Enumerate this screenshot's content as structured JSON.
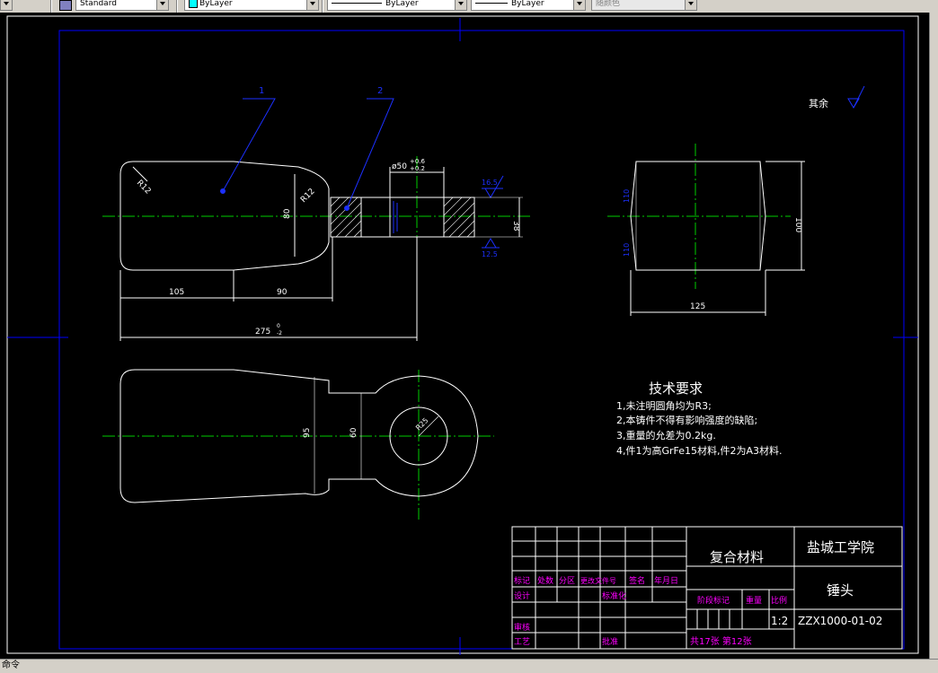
{
  "toolbar": {
    "style_combo": "Standard",
    "layer_combo": "ByLayer",
    "linetype_combo": "ByLayer",
    "lineweight_combo": "ByLayer",
    "plotstyle_combo": "随颜色"
  },
  "command_line": "命令",
  "drawing": {
    "balloon_1": "1",
    "balloon_2": "2",
    "roughness_note": "其余",
    "dims": {
      "r12_a": "R12",
      "r12_b": "R12",
      "d80_front": "80",
      "phi50": "ø50",
      "tol_upper": "+0.6",
      "tol_lower": "+0.2",
      "rough_165": "16.5",
      "rough_125": "12.5",
      "d38": "38",
      "d105": "105",
      "d90": "90",
      "d275": "275",
      "d275_tol_upper": "0",
      "d275_tol_lower": "-2",
      "side_110a": "110",
      "side_110b": "110",
      "side_100": "100",
      "side_125": "125",
      "top_95": "95",
      "top_60": "60",
      "r25": "R25"
    },
    "tech_req": {
      "title": "技术要求",
      "line1": "1,未注明圆角均为R3;",
      "line2": "2,本铸件不得有影响强度的缺陷;",
      "line3": "3,重量的允差为0.2kg.",
      "line4": "4,件1为高GrFe15材料,件2为A3材料."
    },
    "title_block": {
      "h_mark": "标记",
      "h_count": "处数",
      "h_zone": "分区",
      "h_docno": "更改文件号",
      "h_sign": "签名",
      "h_date": "年月日",
      "design": "设计",
      "standardization": "标准化",
      "review": "审核",
      "process": "工艺",
      "approve": "批准",
      "material": "复合材料",
      "school": "盐城工学院",
      "part_name": "锤头",
      "stage_mark": "阶段标记",
      "weight": "重量",
      "scale_label": "比例",
      "scale_value": "1:2",
      "drawing_no": "ZZX1000-01-02",
      "sheets": "共17张 第12张"
    }
  },
  "colors": {
    "background": "#000000",
    "lines": "#ffffff",
    "frame": "#0000ff",
    "center": "#00cc00",
    "title_labels": "#ff00ff",
    "annotation": "#1c30ff"
  }
}
